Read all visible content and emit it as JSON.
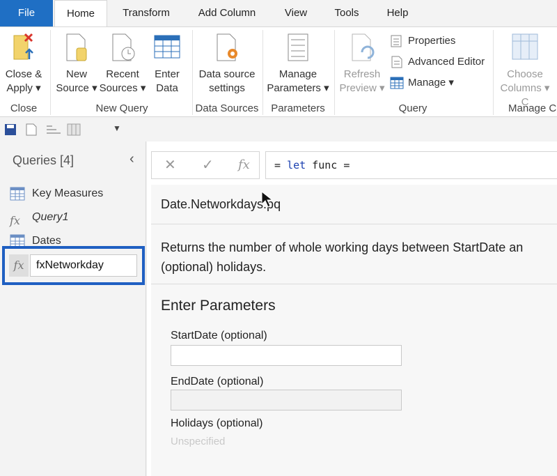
{
  "tabs": [
    "File",
    "Home",
    "Transform",
    "Add Column",
    "View",
    "Tools",
    "Help"
  ],
  "ribbon": {
    "close_apply": {
      "line1": "Close &",
      "line2": "Apply"
    },
    "new_source": {
      "line1": "New",
      "line2": "Source"
    },
    "recent_sources": {
      "line1": "Recent",
      "line2": "Sources"
    },
    "enter_data": {
      "line1": "Enter",
      "line2": "Data"
    },
    "data_source_settings": {
      "line1": "Data source",
      "line2": "settings"
    },
    "manage_parameters": {
      "line1": "Manage",
      "line2": "Parameters"
    },
    "refresh_preview": {
      "line1": "Refresh",
      "line2": "Preview"
    },
    "properties": "Properties",
    "advanced_editor": "Advanced Editor",
    "manage": "Manage",
    "choose_columns": {
      "line1": "Choose",
      "line2": "Columns"
    },
    "groups": {
      "close": "Close",
      "new_query": "New Query",
      "data_sources": "Data Sources",
      "parameters": "Parameters",
      "query": "Query",
      "manage_columns": "Manage C"
    }
  },
  "queries": {
    "header": "Queries [4]",
    "items": [
      {
        "label": "Key Measures",
        "icon": "table-icon"
      },
      {
        "label": "Query1",
        "icon": "fx-icon"
      },
      {
        "label": "Dates",
        "icon": "table-icon"
      }
    ],
    "rename_value": "fxNetworkday"
  },
  "formula": {
    "prefix": "= ",
    "keyword": "let",
    "rest": " func ="
  },
  "function_info": {
    "title": "Date.Networkdays.pq",
    "description_line1": "Returns the number of whole working days between StartDate an",
    "description_line2": "(optional) holidays.",
    "enter_parameters": "Enter Parameters",
    "params": [
      {
        "label": "StartDate (optional)"
      },
      {
        "label": "EndDate (optional)"
      },
      {
        "label": "Holidays (optional)",
        "placeholder": "Unspecified"
      }
    ]
  },
  "colors": {
    "accent": "#1f6fc4",
    "rename_border": "#1f5fc2",
    "keyword": "#1a3fb0"
  }
}
